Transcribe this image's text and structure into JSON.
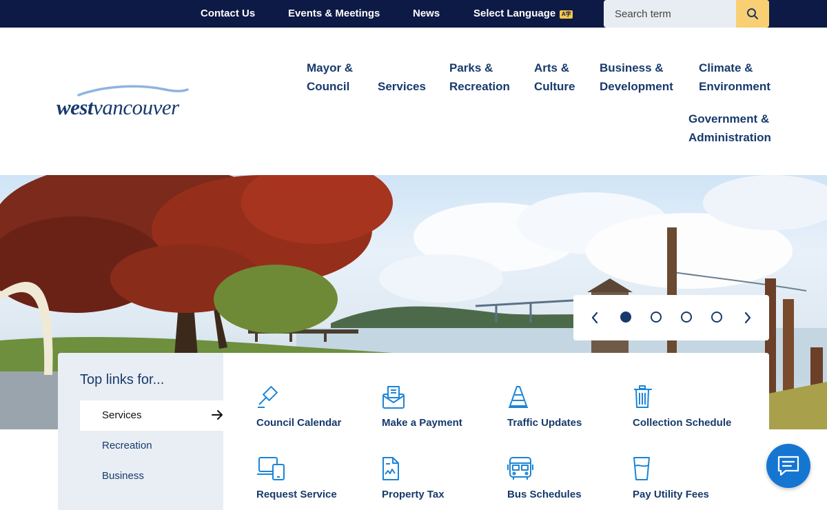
{
  "topbar": {
    "links": [
      "Contact Us",
      "Events & Meetings",
      "News"
    ],
    "select_language": "Select Language",
    "lang_badge": "A字",
    "search_placeholder": "Search term"
  },
  "logo": {
    "word1": "west",
    "word2": "vancouver"
  },
  "nav": {
    "items": [
      {
        "line1": "Mayor &",
        "line2": "Council"
      },
      {
        "line1": "",
        "line2": "Services"
      },
      {
        "line1": "Parks &",
        "line2": "Recreation"
      },
      {
        "line1": "Arts &",
        "line2": "Culture"
      },
      {
        "line1": "Business &",
        "line2": "Development"
      },
      {
        "line1": "Climate &",
        "line2": "Environment"
      },
      {
        "line1": "Government &",
        "line2": "Administration"
      }
    ]
  },
  "carousel": {
    "slide_count": 4,
    "active_slide": 1
  },
  "top_links": {
    "heading": "Top links for...",
    "tabs": [
      "Services",
      "Recreation",
      "Business"
    ],
    "active_tab": "Services",
    "links": [
      {
        "label": "Council Calendar",
        "icon": "gavel-icon"
      },
      {
        "label": "Make a Payment",
        "icon": "envelope-payment-icon"
      },
      {
        "label": "Traffic Updates",
        "icon": "traffic-cone-icon"
      },
      {
        "label": "Collection Schedule",
        "icon": "trash-bin-icon"
      },
      {
        "label": "Request Service",
        "icon": "laptop-phone-icon"
      },
      {
        "label": "Property Tax",
        "icon": "document-chart-icon"
      },
      {
        "label": "Bus Schedules",
        "icon": "bus-icon"
      },
      {
        "label": "Pay Utility Fees",
        "icon": "water-glass-icon"
      }
    ]
  },
  "colors": {
    "navy": "#0d1a45",
    "brand_blue": "#173a6c",
    "accent_yellow": "#f9cf73",
    "icon_blue": "#1b84d6",
    "chat_blue": "#1576d2"
  }
}
